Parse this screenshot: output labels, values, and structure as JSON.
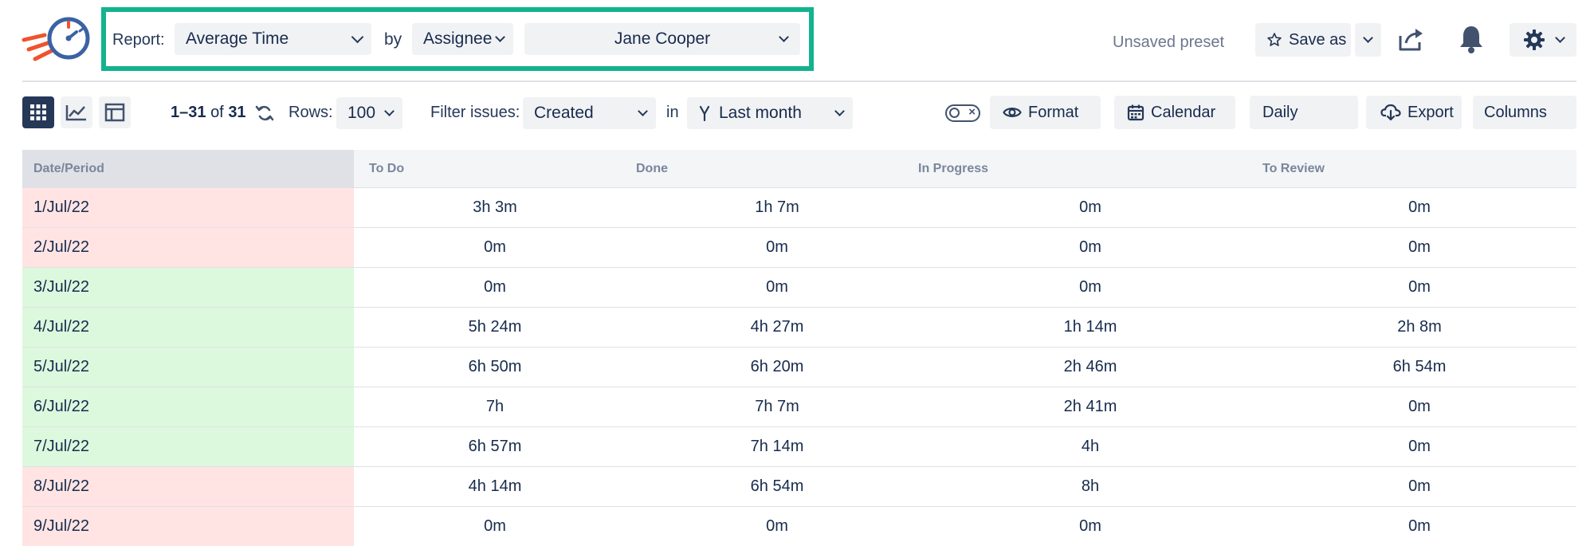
{
  "header": {
    "report_label": "Report:",
    "report_value": "Average Time",
    "by_label": "by",
    "group_value": "Assignee",
    "assignee_value": "Jane Cooper",
    "unsaved_text": "Unsaved preset",
    "save_as_label": "Save as",
    "accent_color": "#12b38e"
  },
  "toolbar": {
    "count_range": "1–31",
    "count_of": "of",
    "count_total": "31",
    "rows_label": "Rows:",
    "rows_value": "100",
    "filter_label": "Filter issues:",
    "filter_value": "Created",
    "in_label": "in",
    "period_value": "Last month",
    "format_label": "Format",
    "calendar_label": "Calendar",
    "granularity_value": "Daily",
    "export_label": "Export",
    "columns_label": "Columns"
  },
  "table": {
    "headers": [
      "Date/Period",
      "To Do",
      "Done",
      "In Progress",
      "To Review"
    ],
    "rows": [
      {
        "date": "1/Jul/22",
        "status": "red",
        "cells": [
          "3h 3m",
          "1h 7m",
          "0m",
          "0m"
        ]
      },
      {
        "date": "2/Jul/22",
        "status": "red",
        "cells": [
          "0m",
          "0m",
          "0m",
          "0m"
        ]
      },
      {
        "date": "3/Jul/22",
        "status": "green",
        "cells": [
          "0m",
          "0m",
          "0m",
          "0m"
        ]
      },
      {
        "date": "4/Jul/22",
        "status": "green",
        "cells": [
          "5h 24m",
          "4h 27m",
          "1h 14m",
          "2h 8m"
        ]
      },
      {
        "date": "5/Jul/22",
        "status": "green",
        "cells": [
          "6h 50m",
          "6h 20m",
          "2h 46m",
          "6h 54m"
        ]
      },
      {
        "date": "6/Jul/22",
        "status": "green",
        "cells": [
          "7h",
          "7h 7m",
          "2h 41m",
          "0m"
        ]
      },
      {
        "date": "7/Jul/22",
        "status": "green",
        "cells": [
          "6h 57m",
          "7h 14m",
          "4h",
          "0m"
        ]
      },
      {
        "date": "8/Jul/22",
        "status": "red",
        "cells": [
          "4h 14m",
          "6h 54m",
          "8h",
          "0m"
        ]
      },
      {
        "date": "9/Jul/22",
        "status": "red",
        "cells": [
          "0m",
          "0m",
          "0m",
          "0m"
        ]
      }
    ]
  },
  "icons": {
    "logo": "stopwatch-rocket-logo",
    "star": "star-icon",
    "share": "share-icon",
    "bell": "bell-icon",
    "settings": "gear-icon"
  }
}
